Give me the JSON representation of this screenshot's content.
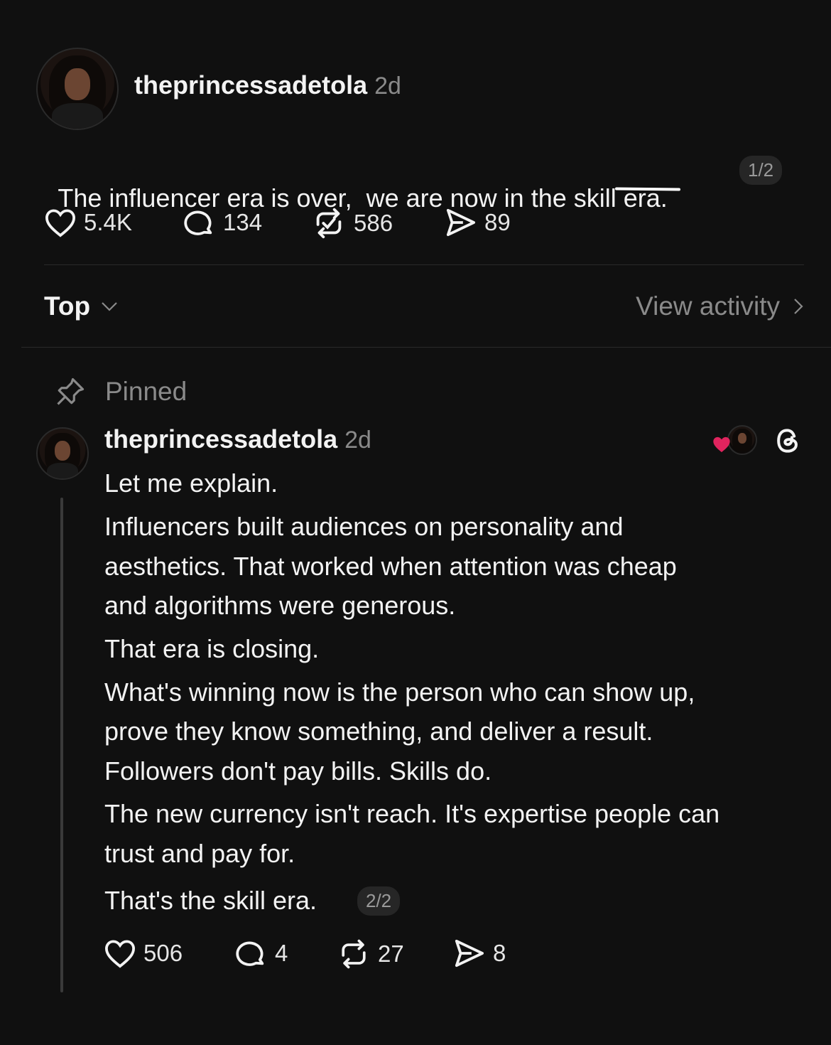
{
  "post": {
    "username": "theprincessadetola",
    "time": "2d",
    "text_before": "The influencer era is over,  we are now in the ",
    "text_underlined": "skill",
    "text_after": " era.",
    "thread_badge": "1/2",
    "likes": "5.4K",
    "replies": "134",
    "reposts": "586",
    "shares": "89"
  },
  "sort": {
    "label": "Top",
    "view_activity": "View activity"
  },
  "reply": {
    "pinned_label": "Pinned",
    "username": "theprincessadetola",
    "time": "2d",
    "lines": [
      "Let me explain.",
      "Influencers built audiences on personality and",
      "aesthetics. That worked when attention was cheap",
      "and algorithms were generous.",
      "That era is closing.",
      "What's winning now is the person who can show up,",
      "prove they know something, and deliver a result.",
      "Followers don't pay bills. Skills do.",
      "The new currency isn't reach. It's expertise people can",
      "trust and pay for.",
      "That's the skill era."
    ],
    "thread_badge": "2/2",
    "likes": "506",
    "replies": "4",
    "reposts": "27",
    "shares": "8"
  },
  "icons": [
    "heart-icon",
    "comment-icon",
    "repost-icon",
    "share-icon",
    "chevron-down-icon",
    "chevron-right-icon",
    "pin-icon",
    "threads-logo-icon"
  ],
  "colors": {
    "background": "#101010",
    "text": "#f3f3f3",
    "muted": "#8a8a8a",
    "divider": "#2a2a2a",
    "like_red": "#e0245e"
  }
}
